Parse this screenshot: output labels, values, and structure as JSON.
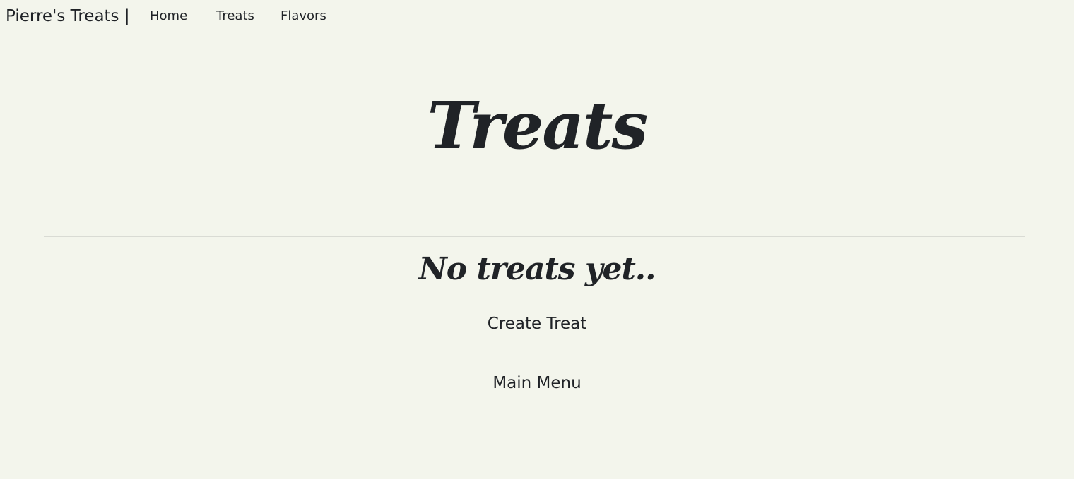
{
  "nav": {
    "brand": "Pierre's Treats |",
    "links": [
      {
        "label": "Home"
      },
      {
        "label": "Treats"
      },
      {
        "label": "Flavors"
      }
    ]
  },
  "main": {
    "heading": "Treats",
    "empty_message": "No treats yet..",
    "create_link": "Create Treat",
    "menu_link": "Main Menu"
  },
  "colors": {
    "background": "#f3f5ec",
    "text": "#1f2226",
    "divider": "#d9dbd4"
  }
}
